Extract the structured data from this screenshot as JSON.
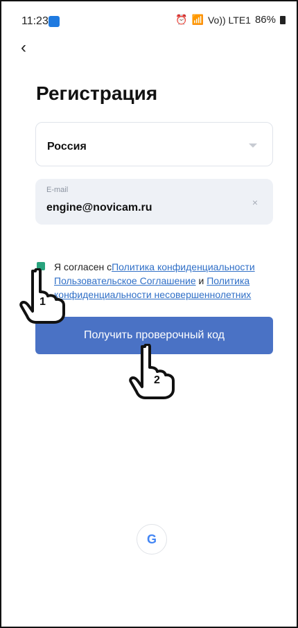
{
  "status": {
    "time": "11:23",
    "signal": "Vo)) LTE1",
    "battery_percent": "86%",
    "icons": [
      "alarm-icon",
      "wifi-icon",
      "signal-icon",
      "battery-icon",
      "app-icon"
    ]
  },
  "nav": {
    "back_icon": "‹"
  },
  "page": {
    "title": "Регистрация"
  },
  "form": {
    "country_value": "Россия",
    "email_label": "E-mail",
    "email_value": "engine@novicam.ru",
    "clear_icon": "×"
  },
  "agreement": {
    "prefix": "Я согласен с",
    "link_privacy": "Политика конфиденциальности",
    "link_terms": "Пользовательское Соглашение",
    "conj": " и ",
    "link_minors": "Политика конфиденциальности несовершеннолетних"
  },
  "buttons": {
    "get_code": "Получить проверочный код"
  },
  "annotations": {
    "pointer_1": "1",
    "pointer_2": "2"
  },
  "social": {
    "google_letter": "G"
  },
  "colors": {
    "primary": "#4a72c5",
    "link": "#2f6fc7",
    "check": "#29a37d"
  }
}
